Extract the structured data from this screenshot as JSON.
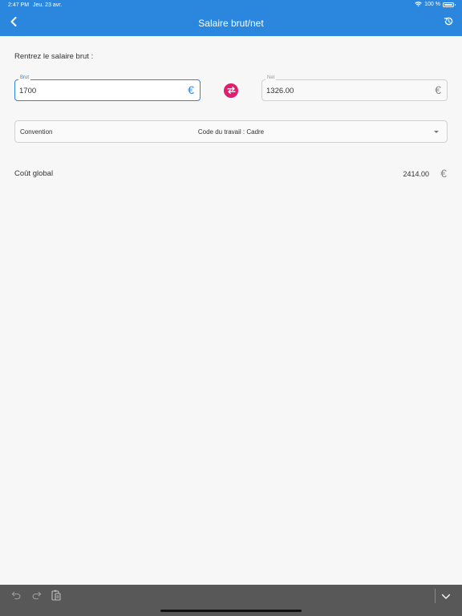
{
  "status_bar": {
    "time": "2:47 PM",
    "date": "Jeu. 23 avr.",
    "battery": "100 %"
  },
  "header": {
    "title": "Salaire brut/net",
    "back_icon": "chevron-left-icon",
    "history_icon": "history-icon"
  },
  "form": {
    "prompt": "Rentrez le salaire brut :",
    "brut": {
      "label": "Brut",
      "value": "1700",
      "currency": "€"
    },
    "net": {
      "label": "Net",
      "value": "1326.00",
      "currency": "€"
    },
    "swap_icon": "swap-arrows-icon",
    "convention": {
      "label": "Convention",
      "value": "Code du travail : Cadre"
    }
  },
  "summary": {
    "cost_label": "Coût global",
    "cost_value": "2414.00",
    "currency": "€"
  },
  "toolbar": {
    "icons": [
      "undo-icon",
      "redo-icon",
      "paste-icon",
      "keyboard-hide-icon"
    ]
  },
  "colors": {
    "accent": "#2a87dd",
    "swap": "#de1f6f",
    "toolbar": "#585858"
  }
}
